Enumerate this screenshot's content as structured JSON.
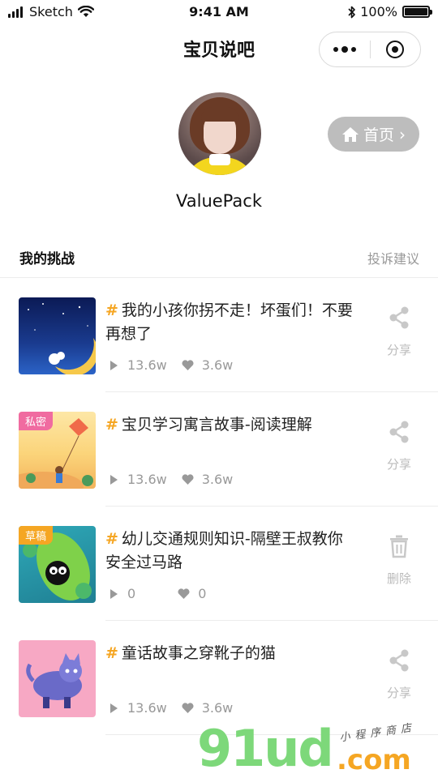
{
  "status_bar": {
    "carrier": "Sketch",
    "time": "9:41 AM",
    "battery": "100%"
  },
  "nav": {
    "title": "宝贝说吧"
  },
  "profile": {
    "username": "ValuePack",
    "home_button_label": "首页"
  },
  "section": {
    "title": "我的挑战",
    "feedback": "投诉建议"
  },
  "items": [
    {
      "title": "我的小孩你拐不走！坏蛋们！不要再想了",
      "badge": "",
      "plays": "13.6w",
      "likes": "3.6w",
      "action": "分享",
      "action_icon": "share-icon"
    },
    {
      "title": "宝贝学习寓言故事-阅读理解",
      "badge": "私密",
      "badge_color": "#f06ba0",
      "plays": "13.6w",
      "likes": "3.6w",
      "action": "分享",
      "action_icon": "share-icon"
    },
    {
      "title": "幼儿交通规则知识-隔壁王叔教你安全过马路",
      "badge": "草稿",
      "badge_color": "#f5a623",
      "plays": "0",
      "likes": "0",
      "action": "删除",
      "action_icon": "trash-icon"
    },
    {
      "title": "童话故事之穿靴子的猫",
      "badge": "",
      "plays": "13.6w",
      "likes": "3.6w",
      "action": "分享",
      "action_icon": "share-icon"
    }
  ],
  "watermark": {
    "logo": "91ud",
    "domain": ".com",
    "tagline": "小程序商店"
  },
  "colors": {
    "accent_hash": "#f5a623",
    "muted": "#999999",
    "home_button_bg": "#bdbdbd"
  }
}
